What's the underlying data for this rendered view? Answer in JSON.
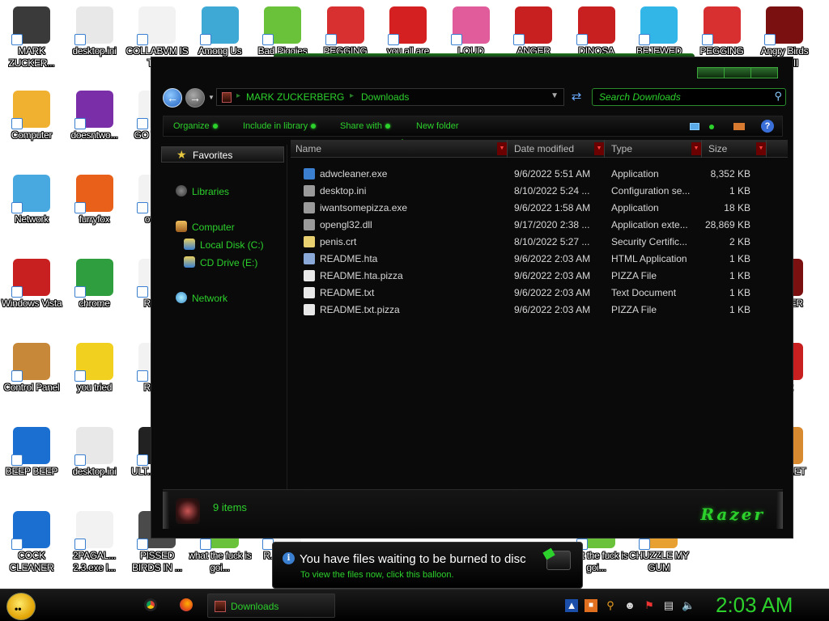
{
  "desktop": {
    "icons": [
      {
        "label": "MARK ZUCKER...",
        "icon": "person-icon",
        "color": "#3a3a3a"
      },
      {
        "label": "desktop.ini",
        "icon": "settings-file-icon",
        "color": "#e8e8e8"
      },
      {
        "label": "COLLABVM IS TH...",
        "icon": "document-icon",
        "color": "#f2f2f2"
      },
      {
        "label": "Among Us",
        "icon": "game-icon",
        "color": "#3fa9d6"
      },
      {
        "label": "Bad Piggies",
        "icon": "pig-game-icon",
        "color": "#6ac23a"
      },
      {
        "label": "PEGGING",
        "icon": "peggle-icon",
        "color": "#d83030"
      },
      {
        "label": "you all are",
        "icon": "devcpp-icon",
        "color": "#d42020"
      },
      {
        "label": "LOUD",
        "icon": "angry-bird-icon",
        "color": "#e05c9a"
      },
      {
        "label": "ANGER",
        "icon": "angry-bird-icon",
        "color": "#c82020"
      },
      {
        "label": "DINOSA",
        "icon": "angry-bird-icon",
        "color": "#c82020"
      },
      {
        "label": "BEJEWED",
        "icon": "diamond-icon",
        "color": "#32b6e8"
      },
      {
        "label": "PEGGING",
        "icon": "peggle-icon",
        "color": "#d83030"
      },
      {
        "label": "Angry Birds ...ars II",
        "icon": "star-wars-icon",
        "color": "#7a1010"
      },
      {
        "label": "Computer",
        "icon": "computer-icon",
        "color": "#f0b030"
      },
      {
        "label": "doesntwo...",
        "icon": "yahoo-icon",
        "color": "#7a2fa8"
      },
      {
        "label": "GO WAC...",
        "icon": "document-icon",
        "color": "#f2f2f2"
      },
      {
        "label": "Network",
        "icon": "network-icon",
        "color": "#48a8e0"
      },
      {
        "label": "furryfox",
        "icon": "firefox-icon",
        "color": "#e8601a"
      },
      {
        "label": "over...",
        "icon": "document-icon",
        "color": "#f2f2f2"
      },
      {
        "label": "Windows Vista",
        "icon": "recycle-bin-icon",
        "color": "#c82020"
      },
      {
        "label": "chrome",
        "icon": "chrome-icon",
        "color": "#2f9e3f"
      },
      {
        "label": "REA...",
        "icon": "document-icon",
        "color": "#f2f2f2"
      },
      {
        "label": "Control Panel",
        "icon": "control-panel-icon",
        "color": "#c8883a"
      },
      {
        "label": "you tried",
        "icon": "star-icon",
        "color": "#f2d020"
      },
      {
        "label": "REA...",
        "icon": "document-icon",
        "color": "#f2f2f2"
      },
      {
        "label": "BEEP BEEP",
        "icon": "blue-panel-icon",
        "color": "#1a6fd0"
      },
      {
        "label": "desktop.ini",
        "icon": "settings-file-icon",
        "color": "#e8e8e8"
      },
      {
        "label": "ULT... BLO...",
        "icon": "document-icon",
        "color": "#222222"
      },
      {
        "label": "COCK CLEANER",
        "icon": "blue-panel-icon",
        "color": "#1a6fd0"
      },
      {
        "label": "2PAGAL... 2.3.exe I...",
        "icon": "document-icon",
        "color": "#f2f2f2"
      },
      {
        "label": "PISSED BIRDS IN ...",
        "icon": "angry-bird-icon",
        "color": "#4a4a4a"
      },
      {
        "label": "what the fuck is goi...",
        "icon": "document-icon",
        "color": "#6ac23a"
      },
      {
        "label": "R... INV...",
        "icon": "document-icon",
        "color": "#f2f2f2"
      },
      {
        "label": "what the fuck is goi...",
        "icon": "document-icon",
        "color": "#6ac23a"
      },
      {
        "label": "CHUZZLE MY GUM",
        "icon": "chuzzle-icon",
        "color": "#e8a030"
      },
      {
        "label": "NO ...ER",
        "icon": "game-icon",
        "color": "#7a1010"
      },
      {
        "label": "...ox",
        "icon": "game-icon",
        "color": "#c82020"
      },
      {
        "label": "...SO ...ET",
        "icon": "box-icon",
        "color": "#d88a30"
      }
    ]
  },
  "explorer": {
    "title_path": [
      "MARK ZUCKERBERG",
      "Downloads"
    ],
    "search_placeholder": "Search Downloads",
    "commands": [
      "Organize",
      "Include in library",
      "Share with",
      "New folder"
    ],
    "nav": {
      "favorites": "Favorites",
      "libraries": "Libraries",
      "computer": "Computer",
      "local_disk": "Local Disk (C:)",
      "cd_drive": "CD Drive (E:)",
      "network": "Network"
    },
    "columns": [
      "Name",
      "Date modified",
      "Type",
      "Size"
    ],
    "files": [
      {
        "name": "adwcleaner.exe",
        "date": "9/6/2022 5:51 AM",
        "type": "Application",
        "size": "8,352 KB",
        "icon": "adwcleaner-icon",
        "color": "#3a7fd0"
      },
      {
        "name": "desktop.ini",
        "date": "8/10/2022 5:24 ...",
        "type": "Configuration se...",
        "size": "1 KB",
        "icon": "settings-file-icon",
        "color": "#9a9a9a"
      },
      {
        "name": "iwantsomepizza.exe",
        "date": "9/6/2022 1:58 AM",
        "type": "Application",
        "size": "18 KB",
        "icon": "application-icon",
        "color": "#9a9a9a"
      },
      {
        "name": "opengl32.dll",
        "date": "9/17/2020 2:38 ...",
        "type": "Application exte...",
        "size": "28,869 KB",
        "icon": "dll-icon",
        "color": "#9a9a9a"
      },
      {
        "name": "penis.crt",
        "date": "8/10/2022 5:27 ...",
        "type": "Security Certific...",
        "size": "2 KB",
        "icon": "certificate-icon",
        "color": "#e8d070"
      },
      {
        "name": "README.hta",
        "date": "9/6/2022 2:03 AM",
        "type": "HTML Application",
        "size": "1 KB",
        "icon": "hta-icon",
        "color": "#8aa8d8"
      },
      {
        "name": "README.hta.pizza",
        "date": "9/6/2022 2:03 AM",
        "type": "PIZZA File",
        "size": "1 KB",
        "icon": "file-icon",
        "color": "#e8e8e8"
      },
      {
        "name": "README.txt",
        "date": "9/6/2022 2:03 AM",
        "type": "Text Document",
        "size": "1 KB",
        "icon": "text-file-icon",
        "color": "#e8e8e8"
      },
      {
        "name": "README.txt.pizza",
        "date": "9/6/2022 2:03 AM",
        "type": "PIZZA File",
        "size": "1 KB",
        "icon": "file-icon",
        "color": "#e8e8e8"
      }
    ],
    "item_count": "9 items",
    "brand": "Razer"
  },
  "balloon": {
    "title": "You have files waiting to be burned to disc",
    "subtitle": "To view the files now, click this balloon."
  },
  "taskbar": {
    "task_label": "Downloads",
    "clock": "2:03 AM"
  },
  "colors": {
    "accent": "#2cd12c",
    "window_bg": "#0a0a0a",
    "text": "#d8d8d8"
  }
}
